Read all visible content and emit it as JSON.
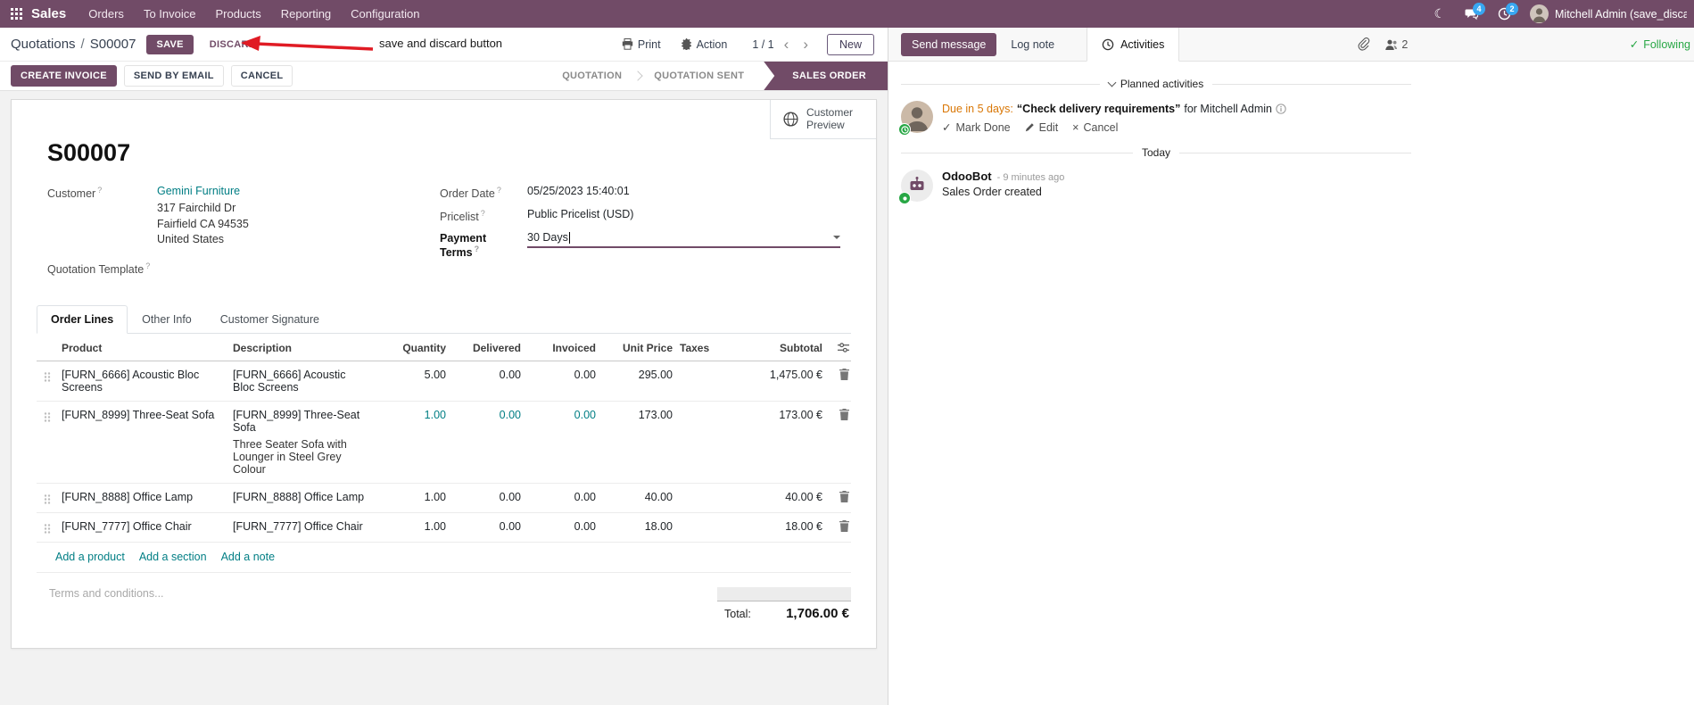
{
  "colors": {
    "brand": "#714B67",
    "link": "#017e84",
    "due": "#d97706",
    "following": "#28a745",
    "badge": "#38a7f1",
    "annotation": "#e01b24"
  },
  "nav": {
    "brand": "Sales",
    "menus": [
      "Orders",
      "To Invoice",
      "Products",
      "Reporting",
      "Configuration"
    ],
    "messages_badge": "4",
    "activities_badge": "2",
    "user_name": "Mitchell Admin (save_discar"
  },
  "control": {
    "breadcrumb_parent": "Quotations",
    "breadcrumb_sep": "/",
    "breadcrumb_current": "S00007",
    "save_label": "SAVE",
    "discard_label": "DISCARD",
    "annotation_text": "save and discard button",
    "print_label": "Print",
    "action_label": "Action",
    "pager": "1 / 1",
    "new_label": "New"
  },
  "statusbar": {
    "create_invoice": "CREATE INVOICE",
    "send_by_email": "SEND BY EMAIL",
    "cancel": "CANCEL",
    "states": [
      "QUOTATION",
      "QUOTATION SENT",
      "SALES ORDER"
    ]
  },
  "sheet": {
    "customer_preview": "Customer Preview",
    "title": "S00007",
    "customer_label": "Customer",
    "customer_name": "Gemini Furniture",
    "address_line1": "317 Fairchild Dr",
    "address_line2": "Fairfield CA 94535",
    "address_line3": "United States",
    "quotation_template_label": "Quotation Template",
    "order_date_label": "Order Date",
    "order_date_value": "05/25/2023 15:40:01",
    "pricelist_label": "Pricelist",
    "pricelist_value": "Public Pricelist (USD)",
    "payment_terms_label": "Payment Terms",
    "payment_terms_value": "30 Days",
    "tabs": [
      "Order Lines",
      "Other Info",
      "Customer Signature"
    ],
    "table": {
      "headers": {
        "product": "Product",
        "description": "Description",
        "quantity": "Quantity",
        "delivered": "Delivered",
        "invoiced": "Invoiced",
        "unit_price": "Unit Price",
        "taxes": "Taxes",
        "subtotal": "Subtotal"
      },
      "rows": [
        {
          "product": "[FURN_6666] Acoustic Bloc Screens",
          "description": "[FURN_6666] Acoustic Bloc Screens",
          "description2": "",
          "quantity": "5.00",
          "delivered": "0.00",
          "invoiced": "0.00",
          "unit_price": "295.00",
          "taxes": "",
          "subtotal": "1,475.00 €"
        },
        {
          "product": "[FURN_8999] Three-Seat Sofa",
          "description": "[FURN_8999] Three-Seat Sofa",
          "description2": "Three Seater Sofa with Lounger in Steel Grey Colour",
          "quantity": "1.00",
          "delivered": "0.00",
          "invoiced": "0.00",
          "unit_price": "173.00",
          "taxes": "",
          "subtotal": "173.00 €"
        },
        {
          "product": "[FURN_8888] Office Lamp",
          "description": "[FURN_8888] Office Lamp",
          "description2": "",
          "quantity": "1.00",
          "delivered": "0.00",
          "invoiced": "0.00",
          "unit_price": "40.00",
          "taxes": "",
          "subtotal": "40.00 €"
        },
        {
          "product": "[FURN_7777] Office Chair",
          "description": "[FURN_7777] Office Chair",
          "description2": "",
          "quantity": "1.00",
          "delivered": "0.00",
          "invoiced": "0.00",
          "unit_price": "18.00",
          "taxes": "",
          "subtotal": "18.00 €"
        }
      ],
      "add_product": "Add a product",
      "add_section": "Add a section",
      "add_note": "Add a note"
    },
    "terms_placeholder": "Terms and conditions...",
    "total_label": "Total:",
    "total_value": "1,706.00 €"
  },
  "chatter": {
    "send_message": "Send message",
    "log_note": "Log note",
    "activities": "Activities",
    "followers_count": "2",
    "following": "Following",
    "planned_header": "Planned activities",
    "activity_due": "Due in 5 days:",
    "activity_summary": "“Check delivery requirements”",
    "activity_for": "for Mitchell Admin",
    "mark_done": "Mark Done",
    "edit": "Edit",
    "cancel": "Cancel",
    "today": "Today",
    "message_author": "OdooBot",
    "message_time": "- 9 minutes ago",
    "message_body": "Sales Order created"
  }
}
